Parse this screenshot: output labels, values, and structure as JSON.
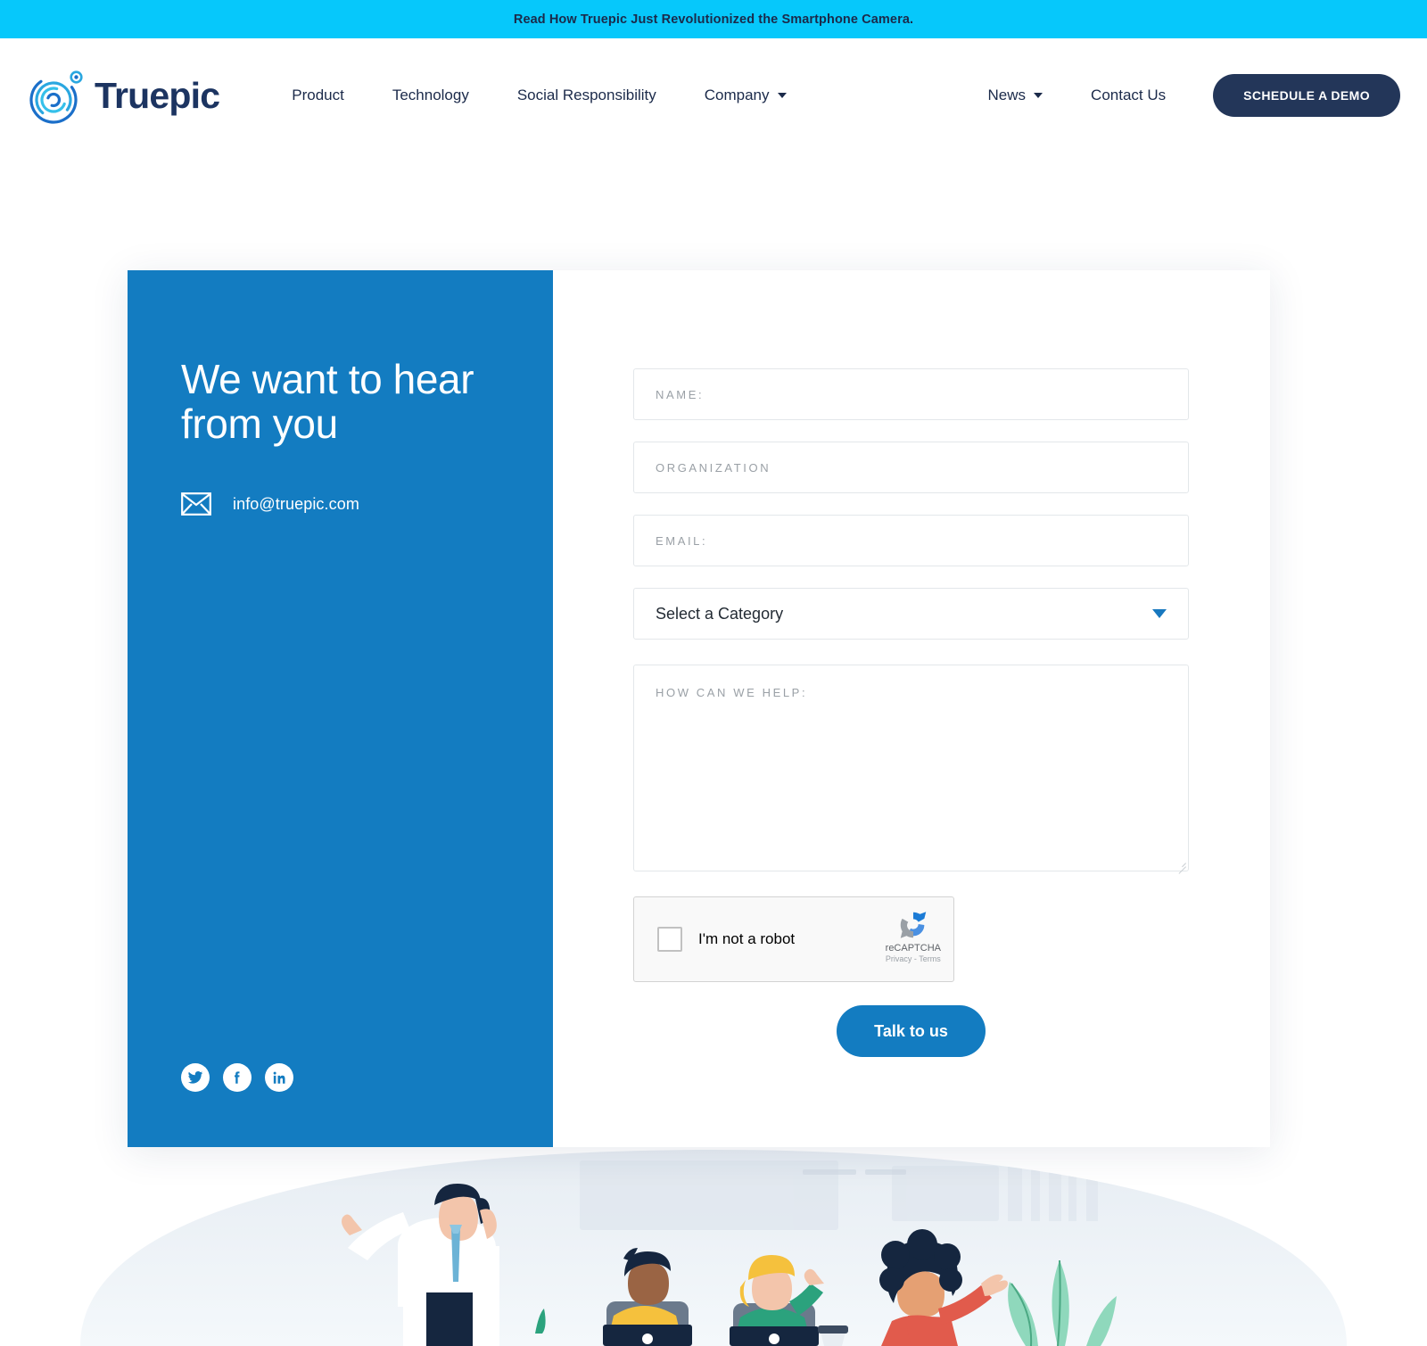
{
  "announcement": {
    "text": "Read How Truepic Just Revolutionized the Smartphone Camera.",
    "bg_color": "#06c8fb",
    "text_color": "#1b2a4a"
  },
  "header": {
    "logo_word": "Truepic",
    "logo_icon": "truepic-spiral-logo",
    "nav_left": [
      {
        "label": "Product",
        "has_caret": false
      },
      {
        "label": "Technology",
        "has_caret": false
      },
      {
        "label": "Social Responsibility",
        "has_caret": false
      },
      {
        "label": "Company",
        "has_caret": true
      }
    ],
    "nav_right": [
      {
        "label": "News",
        "has_caret": true
      },
      {
        "label": "Contact Us",
        "has_caret": false
      }
    ],
    "cta_label": "SCHEDULE A DEMO",
    "cta_color": "#233659"
  },
  "panel": {
    "title": "We want to hear from you",
    "email": "info@truepic.com",
    "mail_icon": "envelope-icon",
    "bg_color": "#137cc1",
    "socials": [
      {
        "name": "twitter",
        "label": "Twitter"
      },
      {
        "name": "facebook",
        "label": "Facebook"
      },
      {
        "name": "linkedin",
        "label": "LinkedIn"
      }
    ]
  },
  "form": {
    "name_placeholder": "NAME:",
    "name_value": "",
    "organization_placeholder": "ORGANIZATION",
    "organization_value": "",
    "email_placeholder": "EMAIL:",
    "email_value": "",
    "category_selected": "Select a Category",
    "category_options": [
      "Select a Category"
    ],
    "message_placeholder": "HOW CAN WE HELP:",
    "message_value": "",
    "submit_label": "Talk to us",
    "submit_color": "#137cc1"
  },
  "recaptcha": {
    "checkbox_label": "I'm not a robot",
    "brand": "reCAPTCHA",
    "links": "Privacy - Terms",
    "logo_icon": "recaptcha-logo-icon"
  },
  "illustration": {
    "name": "office-team-illustration",
    "description": "Flat illustration of office workers with laptops and a plant"
  }
}
